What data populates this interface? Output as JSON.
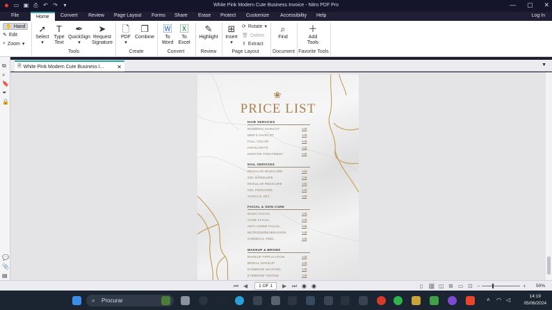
{
  "window": {
    "title": "White Pink Modern Cute Business Invoice - Nitro PDF Pro",
    "login_label": "Log In",
    "controls": [
      "—",
      "▢",
      "✕"
    ]
  },
  "menu_tabs": [
    "File",
    "Home",
    "Convert",
    "Review",
    "Page Layout",
    "Forms",
    "Share",
    "Erase",
    "Protect",
    "Customize",
    "Accessibility",
    "Help"
  ],
  "active_tab": "Home",
  "ribbon": {
    "modes": [
      "Hand",
      "Edit",
      "Zoom"
    ],
    "tools": {
      "select": "Select",
      "type_text": [
        "Type",
        "Text"
      ],
      "quicksign": "QuickSign",
      "request_signature": [
        "Request",
        "Signature"
      ],
      "group": "Tools"
    },
    "create": {
      "pdf": "PDF",
      "combine": "Combine",
      "group": "Create"
    },
    "convert": {
      "to_word": [
        "To",
        "Word"
      ],
      "to_excel": [
        "To",
        "Excel"
      ],
      "group": "Convert"
    },
    "review": {
      "highlight": "Highlight",
      "group": "Review"
    },
    "page_layout": {
      "insert": "Insert",
      "rotate": "Rotate",
      "delete": "Delete",
      "extract": "Extract",
      "group": "Page Layout"
    },
    "document": {
      "find": "Find",
      "group": "Document"
    },
    "favorite_tools": {
      "add_tools": [
        "Add",
        "Tools"
      ],
      "group": "Favorite Tools"
    }
  },
  "doc_tab": {
    "label": "White Pink Modern Cute Business I..."
  },
  "document": {
    "title": "PRICE LIST",
    "sections": [
      {
        "name": "HAIR SERVICES",
        "items": [
          {
            "label": "WOMEN'S HAIRCUT",
            "price": "10$"
          },
          {
            "label": "MEN'S HAIRCUT",
            "price": "10$"
          },
          {
            "label": "FULL COLOR",
            "price": "10$"
          },
          {
            "label": "HIGHLIGHTS",
            "price": "10$"
          },
          {
            "label": "KERATIN TREATMENT",
            "price": "10$"
          }
        ]
      },
      {
        "name": "NAIL SERVICES",
        "items": [
          {
            "label": "REGULAR MANICURE",
            "price": "10$"
          },
          {
            "label": "GEL MANICURE",
            "price": "10$"
          },
          {
            "label": "REGULAR PEDICURE",
            "price": "10$"
          },
          {
            "label": "GEL PEDICURE",
            "price": "10$"
          },
          {
            "label": "ACRYLIC SET",
            "price": "10$"
          }
        ]
      },
      {
        "name": "FACIAL & SKIN CARE",
        "items": [
          {
            "label": "BASIC FACIAL",
            "price": "10$"
          },
          {
            "label": "ACNE FACIAL",
            "price": "10$"
          },
          {
            "label": "ANTI-AGING FACIAL",
            "price": "10$"
          },
          {
            "label": "MICRODERMABRASION",
            "price": "10$"
          },
          {
            "label": "CHEMICAL PEEL",
            "price": "10$"
          }
        ]
      },
      {
        "name": "MAKEUP & BROWS",
        "items": [
          {
            "label": "MAKEUP APPLICATION",
            "price": "10$"
          },
          {
            "label": "BRIDAL MAKEUP",
            "price": "10$"
          },
          {
            "label": "EYEBROW SHAPING",
            "price": "10$"
          },
          {
            "label": "EYEBROW TINTING",
            "price": "10$"
          }
        ]
      }
    ],
    "accent_color": "#a9824f"
  },
  "status": {
    "page_indicator": "1 OF 1",
    "zoom": "50%"
  },
  "taskbar": {
    "search_placeholder": "Procurar",
    "time": "14:19",
    "date": "05/06/2024"
  }
}
